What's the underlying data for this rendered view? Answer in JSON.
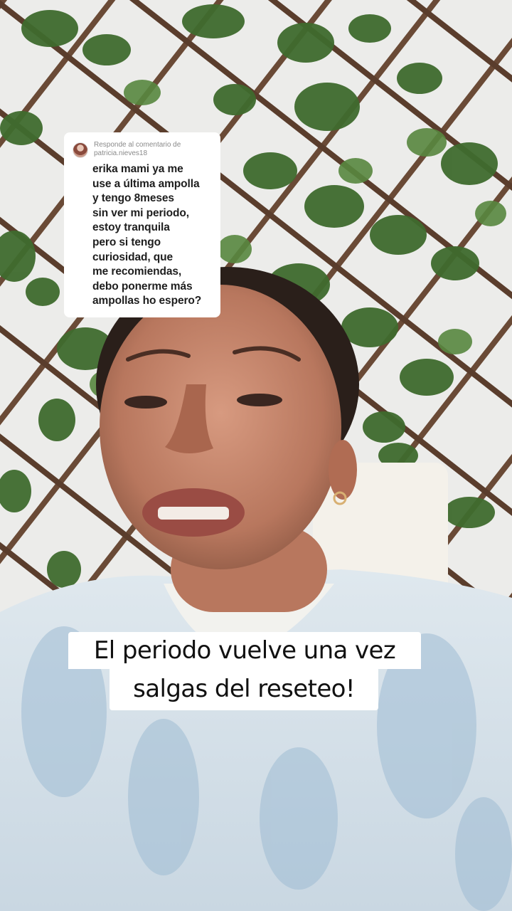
{
  "reply_comment": {
    "header": "Responde al comentario de",
    "username": "patricia.nieves18",
    "lines": [
      "erika mami ya me",
      "use a última ampolla",
      "y tengo 8meses",
      "sin ver mi periodo,",
      "estoy tranquila",
      "pero si tengo",
      "curiosidad, que",
      "me recomiendas,",
      "debo ponerme más",
      "ampollas ho espero?"
    ]
  },
  "caption": {
    "line1": "El periodo vuelve una vez",
    "line2": "salgas del reseteo!"
  },
  "colors": {
    "card_background": "#ffffff",
    "caption_background": "#ffffff",
    "text_primary": "#111111",
    "text_muted": "#8a8a8a"
  }
}
